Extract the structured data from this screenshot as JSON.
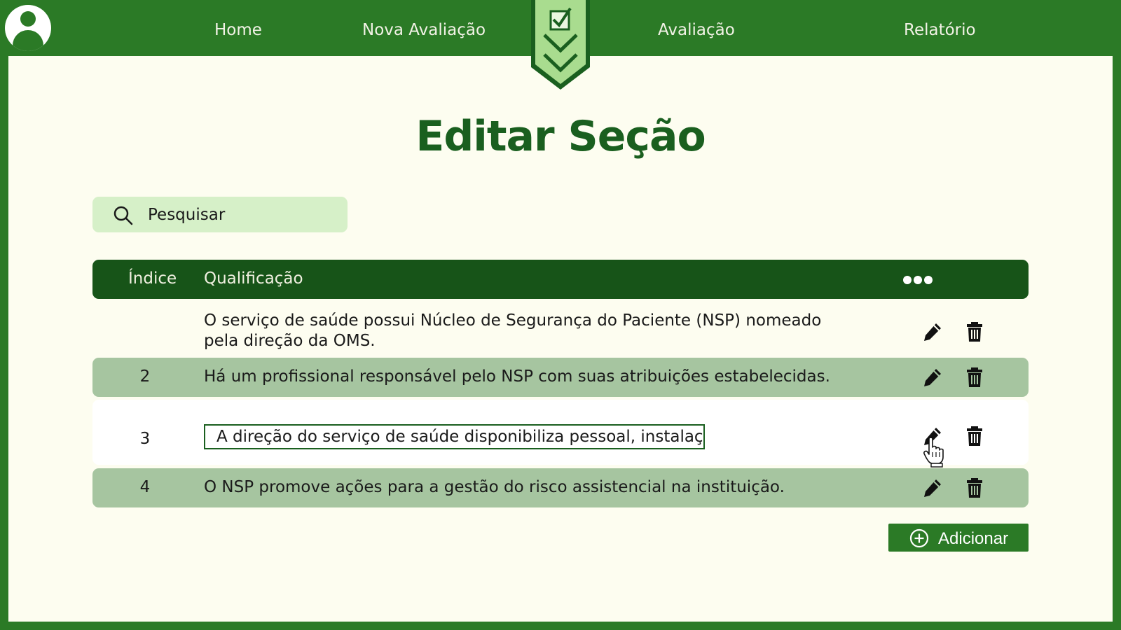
{
  "nav": {
    "items": [
      {
        "label": "Home"
      },
      {
        "label": "Nova Avaliação"
      },
      {
        "label": "Avaliação"
      },
      {
        "label": "Relatório"
      }
    ]
  },
  "page": {
    "title": "Editar Seção"
  },
  "search": {
    "placeholder": "Pesquisar",
    "icon": "search-icon"
  },
  "table": {
    "headers": {
      "index": "Índice",
      "qualification": "Qualificação",
      "more": "more-options-icon"
    },
    "rows": [
      {
        "index": "",
        "text": "O serviço de saúde possui Núcleo de Segurança do Paciente (NSP) nomeado pela direção da OMS."
      },
      {
        "index": "2",
        "text": "Há um profissional responsável pelo NSP com suas atribuições estabelecidas."
      },
      {
        "index": "3",
        "text": "A direção do serviço de saúde disponibiliza pessoal, instalaç",
        "editing": true
      },
      {
        "index": "4",
        "text": "O NSP promove ações para a gestão do risco assistencial na instituição."
      }
    ]
  },
  "actions": {
    "add_label": "Adicionar"
  },
  "colors": {
    "brand_green": "#2b7a26",
    "header_dark_green": "#175418",
    "title_green": "#1a5f1f",
    "row_alt": "#a6c5a0",
    "search_bg": "#d6f0c8",
    "page_bg": "#fdfdf0"
  }
}
